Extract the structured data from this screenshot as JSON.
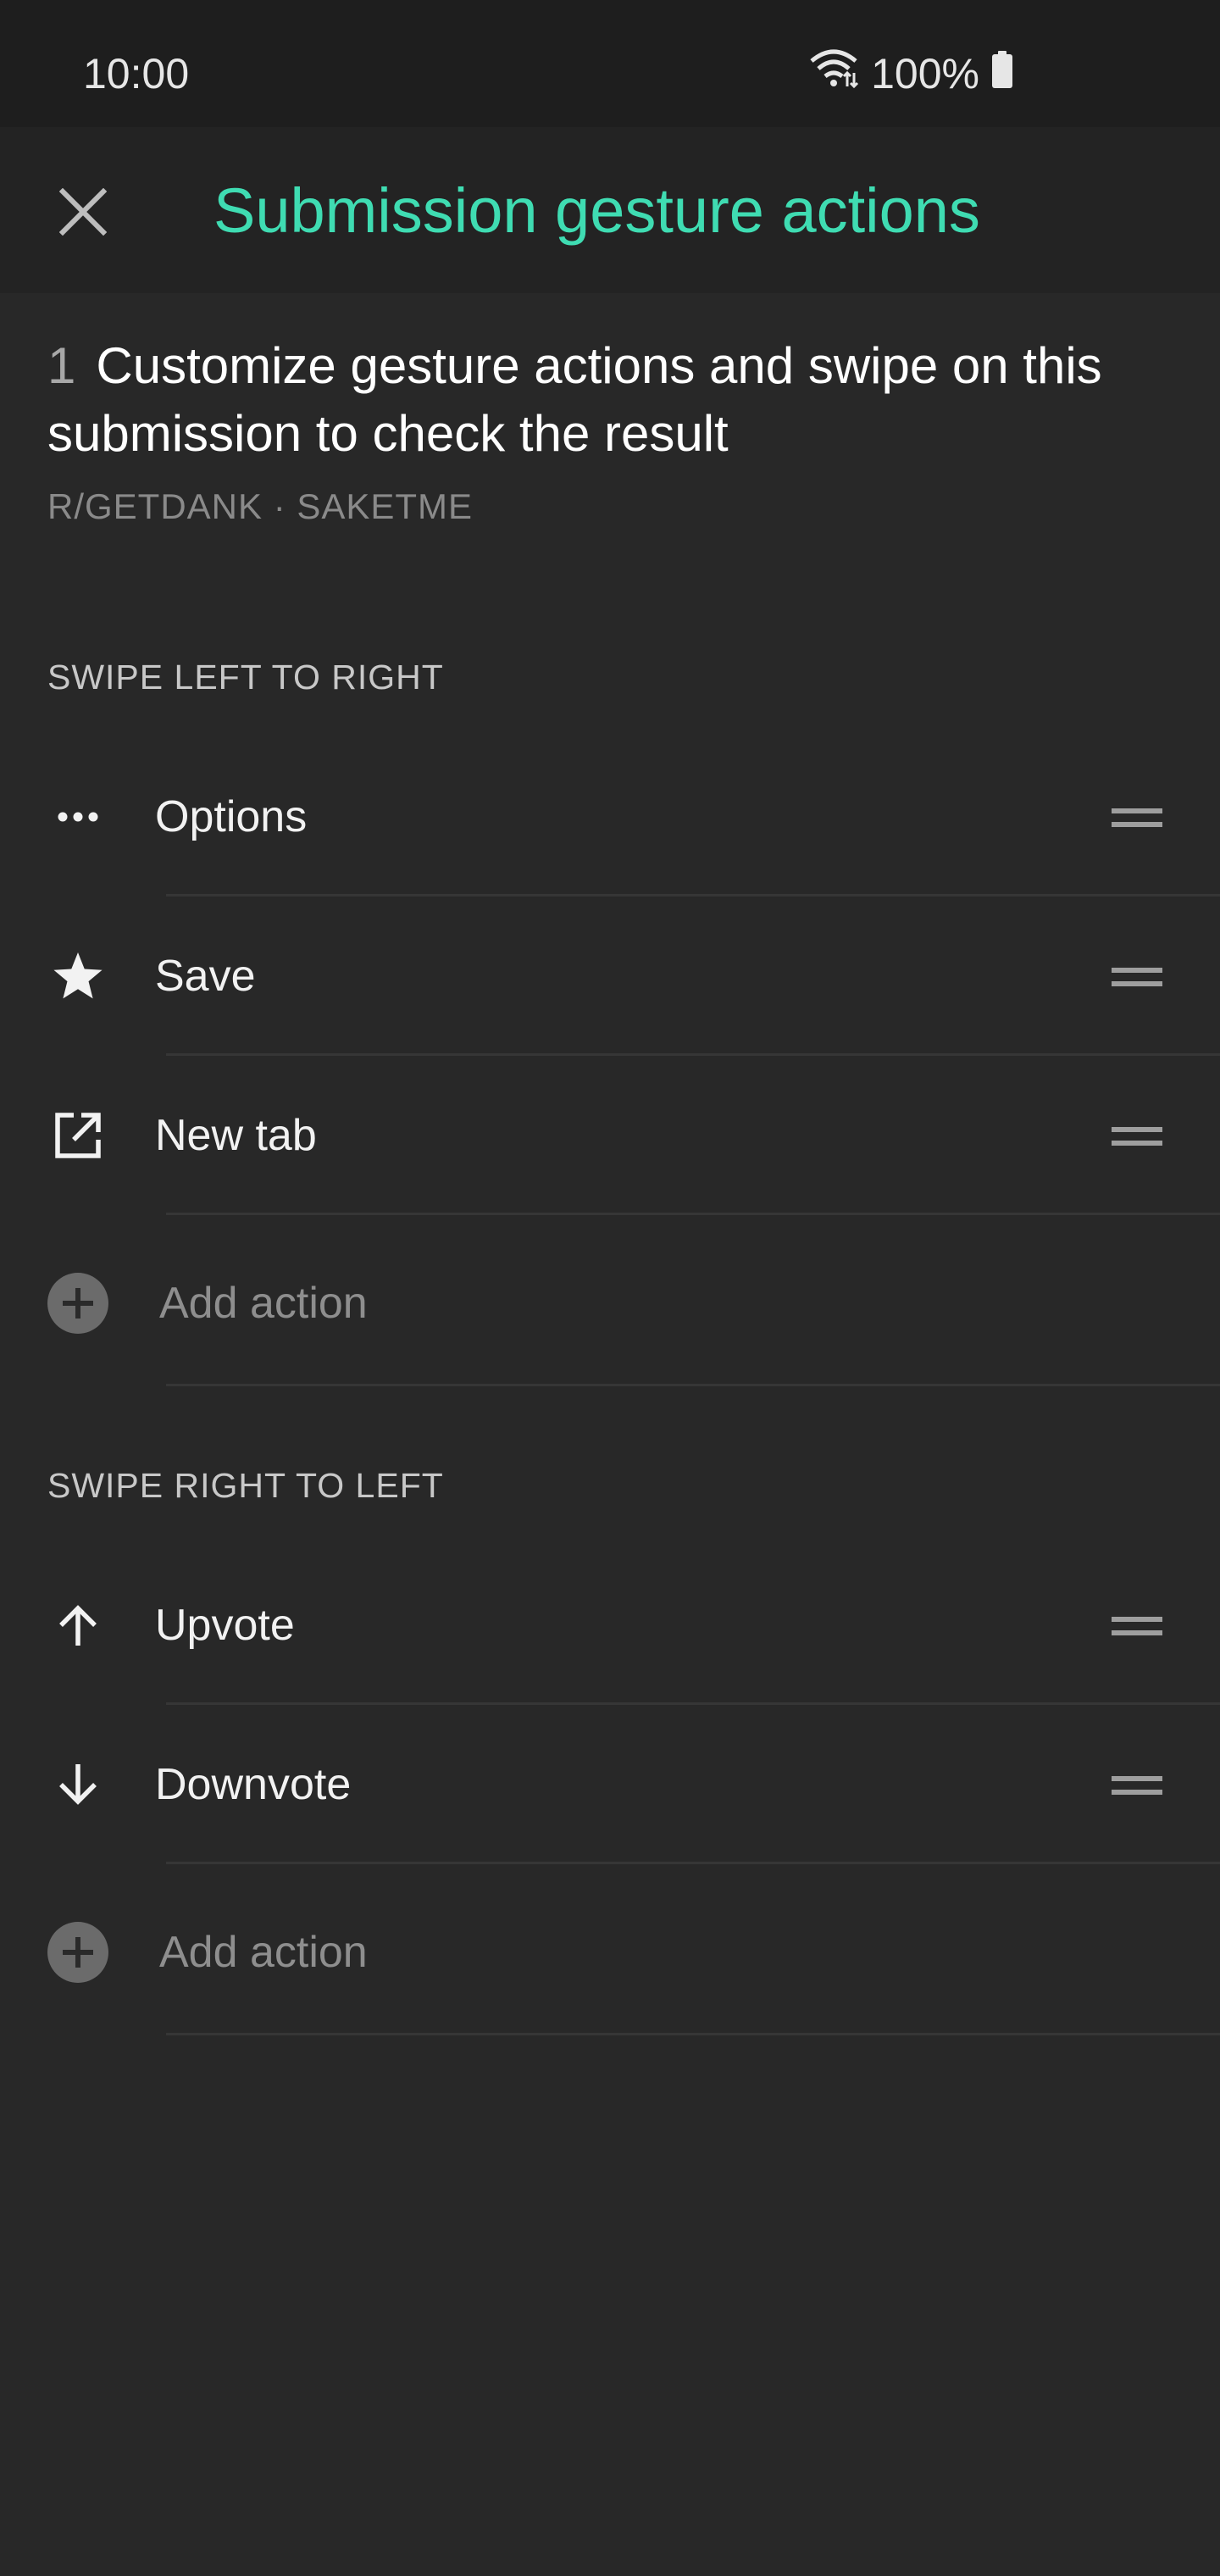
{
  "status_bar": {
    "time": "10:00",
    "battery": "100%"
  },
  "toolbar": {
    "title": "Submission gesture actions"
  },
  "post": {
    "score": "1",
    "title": "Customize gesture actions and swipe on this submission to check the result",
    "meta": "R/GETDANK · SAKETME"
  },
  "swipe_left_to_right": {
    "header": "SWIPE LEFT TO RIGHT",
    "items": [
      {
        "label": "Options",
        "icon": "more-horiz-icon"
      },
      {
        "label": "Save",
        "icon": "star-icon"
      },
      {
        "label": "New tab",
        "icon": "open-in-new-icon"
      }
    ],
    "add_label": "Add action"
  },
  "swipe_right_to_left": {
    "header": "SWIPE RIGHT TO LEFT",
    "items": [
      {
        "label": "Upvote",
        "icon": "arrow-up-icon"
      },
      {
        "label": "Downvote",
        "icon": "arrow-down-icon"
      }
    ],
    "add_label": "Add action"
  },
  "colors": {
    "accent": "#3fdcb2",
    "background": "#282828",
    "toolbar": "#232323",
    "status_bar": "#1e1e1e"
  }
}
